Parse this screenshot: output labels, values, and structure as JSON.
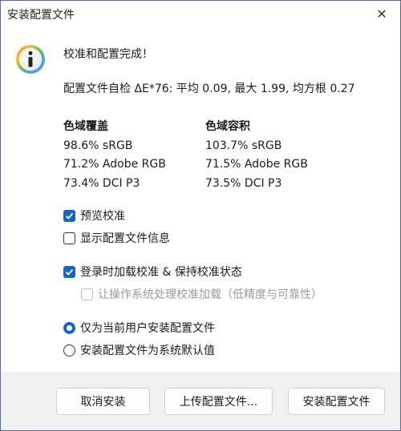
{
  "window": {
    "title": "安装配置文件",
    "close_glyph": "✕"
  },
  "message": {
    "headline": "校准和配置完成！",
    "selfcheck": "配置文件自检 ΔE*76: 平均 0.09, 最大 1.99, 均方根 0.27"
  },
  "gamut": {
    "coverage": {
      "header": "色域覆盖",
      "rows": [
        "98.6% sRGB",
        "71.2% Adobe RGB",
        "73.4% DCI P3"
      ]
    },
    "volume": {
      "header": "色域容积",
      "rows": [
        "103.7% sRGB",
        "71.5% Adobe RGB",
        "73.5% DCI P3"
      ]
    }
  },
  "options": {
    "preview_calibration": {
      "label": "预览校准",
      "checked": true
    },
    "show_profile_info": {
      "label": "显示配置文件信息",
      "checked": false
    },
    "load_on_login": {
      "label": "登录时加载校准 & 保持校准状态",
      "checked": true
    },
    "os_load": {
      "label": "让操作系统处理校准加载（低精度与可靠性）",
      "checked": false,
      "disabled": true
    }
  },
  "install_scope": {
    "current_user": {
      "label": "仅为当前用户安装配置文件",
      "selected": true
    },
    "system_default": {
      "label": "安装配置文件为系统默认值",
      "selected": false
    }
  },
  "buttons": {
    "cancel": "取消安装",
    "upload": "上传配置文件...",
    "install": "安装配置文件"
  },
  "colors": {
    "accent": "#1565c0",
    "border": "#4a6f9c"
  }
}
